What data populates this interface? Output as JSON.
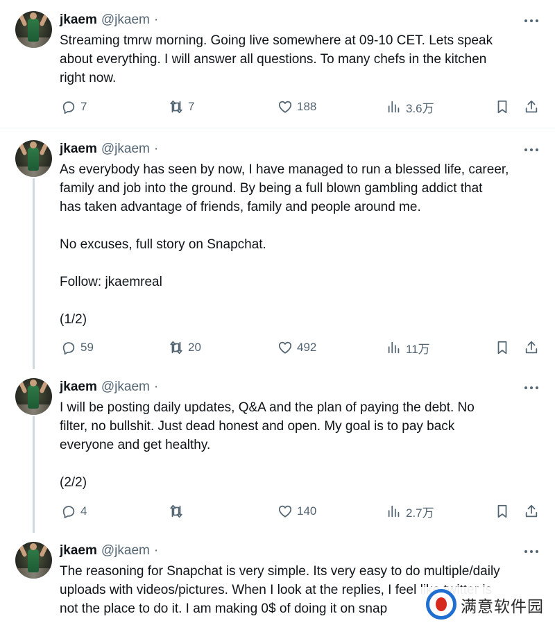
{
  "tweets": [
    {
      "name": "jkaem",
      "handle": "@jkaem",
      "separator": "·",
      "text": "Streaming tmrw morning. Going live somewhere at 09-10 CET. Lets speak\nabout everything. I will answer all questions. To many chefs in the kitchen\nright now.",
      "replies": "7",
      "retweets": "7",
      "likes": "188",
      "views": "3.6万"
    },
    {
      "name": "jkaem",
      "handle": "@jkaem",
      "separator": "·",
      "text": "As everybody has seen by now, I have managed to run a blessed life, career,\nfamily and job into the ground. By being a full blown gambling addict that\nhas taken advantage of friends, family and people around me.\n\nNo excuses, full story on Snapchat.\n\nFollow: jkaemreal\n\n(1/2)",
      "replies": "59",
      "retweets": "20",
      "likes": "492",
      "views": "11万"
    },
    {
      "name": "jkaem",
      "handle": "@jkaem",
      "separator": "·",
      "text": "I will be posting daily updates, Q&A and the plan of paying the debt. No\nfilter, no bullshit. Just dead honest and open. My goal is to pay back\neveryone and get healthy.\n\n(2/2)",
      "replies": "4",
      "retweets": "",
      "likes": "140",
      "views": "2.7万"
    },
    {
      "name": "jkaem",
      "handle": "@jkaem",
      "separator": "·",
      "text": "The reasoning for Snapchat is very simple. Its very easy to do multiple/daily\nuploads with videos/pictures. When I look at the replies, I feel like twitter is\nnot the place to do it. I am making 0$ of doing it on snap"
    }
  ],
  "icons": {
    "reply": "reply-icon",
    "retweet": "retweet-icon",
    "like": "heart-icon",
    "views": "views-icon",
    "bookmark": "bookmark-icon",
    "share": "share-icon",
    "more": "more-icon"
  },
  "watermark": {
    "text": "满意软件园"
  },
  "colors": {
    "text": "#0f1419",
    "secondary": "#536471",
    "thread_line": "#cfd9de",
    "separator": "#eff3f4"
  }
}
